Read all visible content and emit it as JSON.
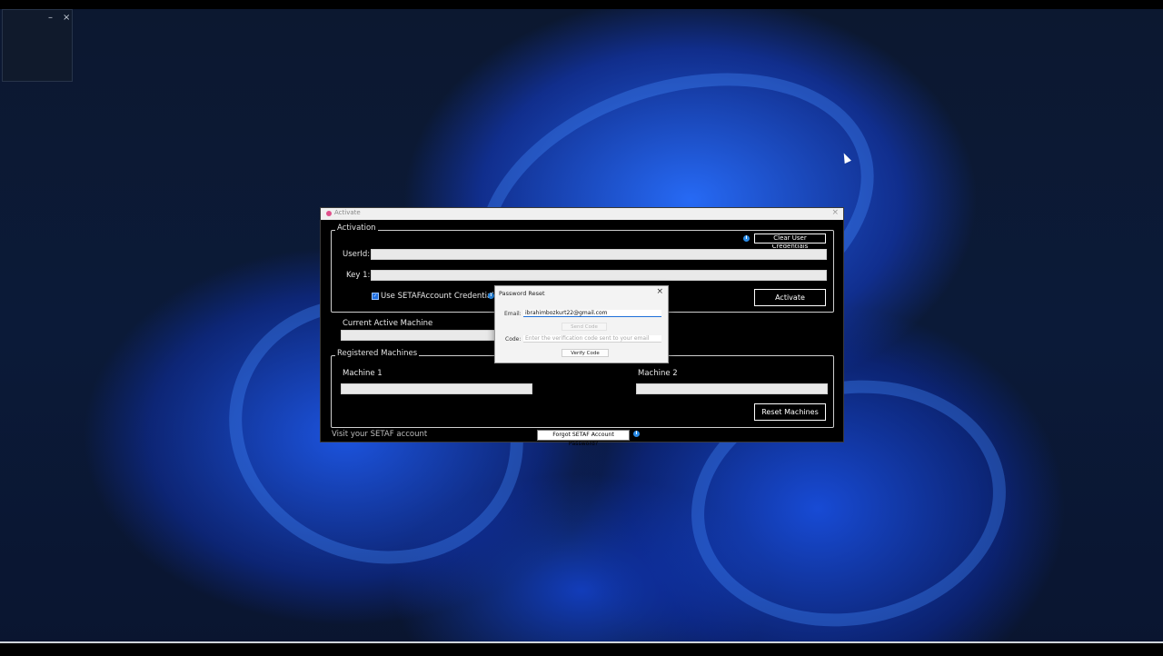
{
  "window": {
    "title": "Activate",
    "close_glyph": "×"
  },
  "activation": {
    "legend": "Activation",
    "clear_button": "Clear User Credentials",
    "userid_label": "UserId:",
    "key_label": "Key 1:",
    "checkbox_label": "Use SETAFAccount Credentials",
    "checkbox_checked": true,
    "activate_button": "Activate"
  },
  "current_machine": {
    "label": "Current Active Machine"
  },
  "registered": {
    "legend": "Registered Machines",
    "machine1_label": "Machine 1",
    "machine2_label": "Machine 2",
    "reset_button": "Reset Machines"
  },
  "footer": {
    "visit_text": "Visit your SETAF account",
    "forgot_button": "Forgot SETAF Account Password?"
  },
  "password_reset": {
    "title": "Password Reset",
    "close_glyph": "×",
    "email_label": "Email:",
    "email_value": "ibrahimbozkurt22@gmail.com",
    "send_code_button": "Send Code",
    "code_label": "Code:",
    "code_placeholder": "Enter the verification code sent to your email",
    "verify_button": "Verify Code"
  },
  "mini_window": {
    "minimize_glyph": "–",
    "close_glyph": "×"
  },
  "icons": {
    "info": "info-icon",
    "check": "✓"
  },
  "colors": {
    "accent": "#2a8be6",
    "window_bg": "#000000"
  }
}
